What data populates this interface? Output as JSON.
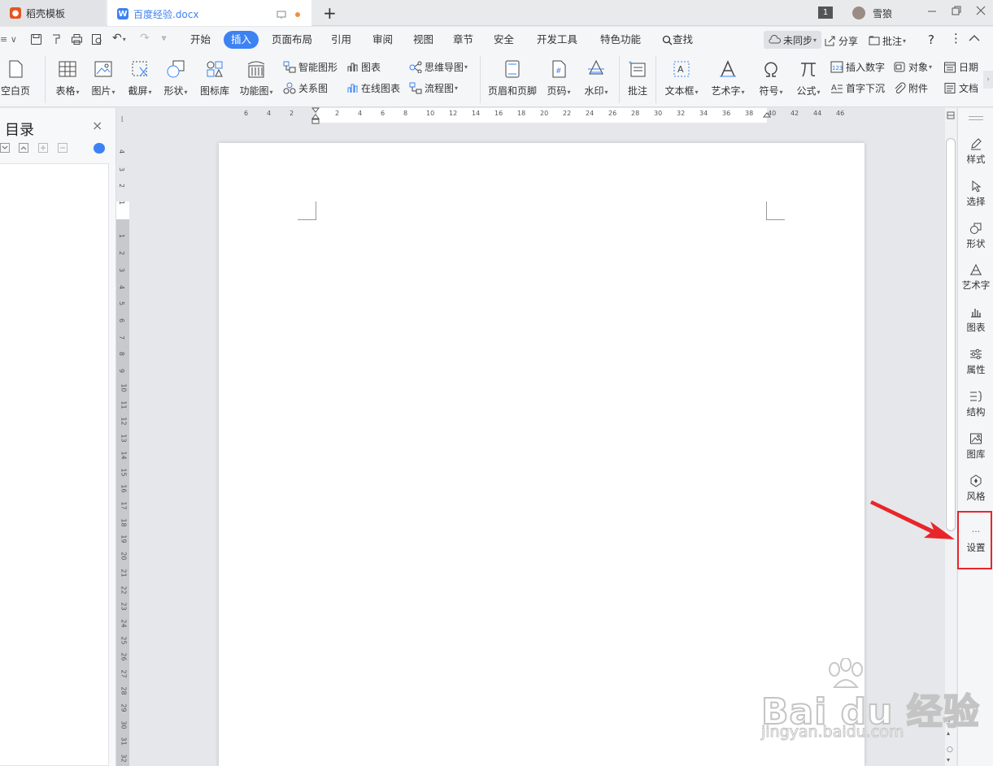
{
  "titlebar": {
    "tabs": [
      {
        "label": "稻壳模板"
      },
      {
        "label": "百度经验.docx"
      }
    ],
    "new_tab": "+",
    "badge": "1",
    "username": "雪狼"
  },
  "menu": {
    "items": [
      "开始",
      "插入",
      "页面布局",
      "引用",
      "审阅",
      "视图",
      "章节",
      "安全",
      "开发工具",
      "特色功能",
      "查找"
    ],
    "active": "插入",
    "sync_status": "未同步",
    "share": "分享",
    "comment": "批注",
    "help": "?"
  },
  "ribbon": {
    "blank_page": "空白页",
    "table": "表格",
    "picture": "图片",
    "screenshot": "截屏",
    "shape": "形状",
    "icon_lib": "图标库",
    "func_chart": "功能图",
    "smart_art": "智能图形",
    "chart": "图表",
    "mindmap": "思维导图",
    "relation": "关系图",
    "online_chart": "在线图表",
    "flowchart": "流程图",
    "header_footer": "页眉和页脚",
    "page_number": "页码",
    "watermark": "水印",
    "comment": "批注",
    "textbox": "文本框",
    "wordart": "艺术字",
    "symbol": "符号",
    "formula": "公式",
    "insert_number": "插入数字",
    "object": "对象",
    "date": "日期",
    "dropcap": "首字下沉",
    "attachment": "附件",
    "doc": "文档"
  },
  "toc_panel": {
    "title": "目录",
    "close": "×"
  },
  "hruler_ticks": [
    "6",
    "4",
    "2",
    "2",
    "4",
    "6",
    "8",
    "10",
    "12",
    "14",
    "16",
    "18",
    "20",
    "22",
    "24",
    "26",
    "28",
    "30",
    "32",
    "34",
    "36",
    "38",
    "40",
    "42",
    "44",
    "46"
  ],
  "vruler_ticks": [
    "4",
    "3",
    "2",
    "1",
    "1",
    "2",
    "3",
    "4",
    "5",
    "6",
    "7",
    "8",
    "9",
    "10",
    "11",
    "12",
    "13",
    "14",
    "15",
    "16",
    "17",
    "18",
    "19",
    "20",
    "21",
    "22",
    "23",
    "24",
    "25",
    "26",
    "27",
    "28",
    "29",
    "30",
    "31",
    "32"
  ],
  "right_sidebar": {
    "items": [
      "样式",
      "选择",
      "形状",
      "艺术字",
      "图表",
      "属性",
      "结构",
      "图库",
      "风格",
      "设置"
    ],
    "more": "···"
  },
  "watermark": {
    "brand": "Bai du 经验",
    "url": "jingyan.baidu.com"
  },
  "colors": {
    "accent": "#3d82f2",
    "highlight_box": "#e8262a",
    "arrow": "#e8262a"
  }
}
